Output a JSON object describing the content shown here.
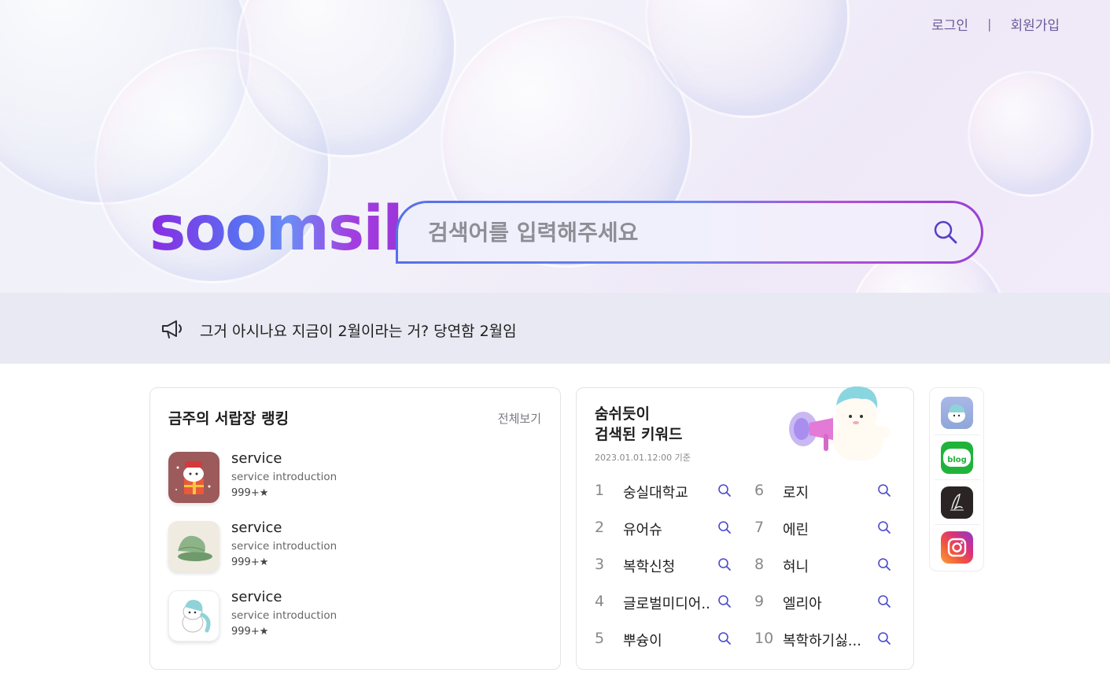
{
  "nav": {
    "login": "로그인",
    "separator": "|",
    "signup": "회원가입"
  },
  "brand": {
    "logo_text": "soomsil"
  },
  "search": {
    "placeholder": "검색어를 입력해주세요",
    "icon": "search-icon"
  },
  "notice": {
    "icon": "megaphone-icon",
    "text": "그거 아시나요 지금이 2월이라는 거? 당연함 2월임"
  },
  "ranking": {
    "title": "금주의 서랍장 랭킹",
    "view_all": "전체보기",
    "items": [
      {
        "name": "service",
        "description": "service introduction",
        "score": "999+★",
        "thumb": "gift-mascot"
      },
      {
        "name": "service",
        "description": "service introduction",
        "score": "999+★",
        "thumb": "shell"
      },
      {
        "name": "service",
        "description": "service introduction",
        "score": "999+★",
        "thumb": "unicorn"
      }
    ]
  },
  "keywords": {
    "title_line1": "숨쉬듯이",
    "title_line2": "검색된 키워드",
    "date": "2023.01.01.12:00 기준",
    "items": [
      {
        "rank": "1",
        "word": "숭실대학교"
      },
      {
        "rank": "2",
        "word": "유어슈"
      },
      {
        "rank": "3",
        "word": "복학신청"
      },
      {
        "rank": "4",
        "word": "글로벌미디어..."
      },
      {
        "rank": "5",
        "word": "뿌슝이"
      },
      {
        "rank": "6",
        "word": "로지"
      },
      {
        "rank": "7",
        "word": "에린"
      },
      {
        "rank": "8",
        "word": "혀니"
      },
      {
        "rank": "9",
        "word": "엘리아"
      },
      {
        "rank": "10",
        "word": "복학하기싫..."
      }
    ]
  },
  "social": {
    "items": [
      {
        "name": "soomsil-mascot-icon"
      },
      {
        "name": "blog-icon",
        "label": "blog"
      },
      {
        "name": "signature-icon"
      },
      {
        "name": "instagram-icon"
      }
    ]
  },
  "colors": {
    "accent": "#6a5a9a",
    "notice_bg": "#e8e9f2",
    "search_icon": "#5a4ad0"
  }
}
